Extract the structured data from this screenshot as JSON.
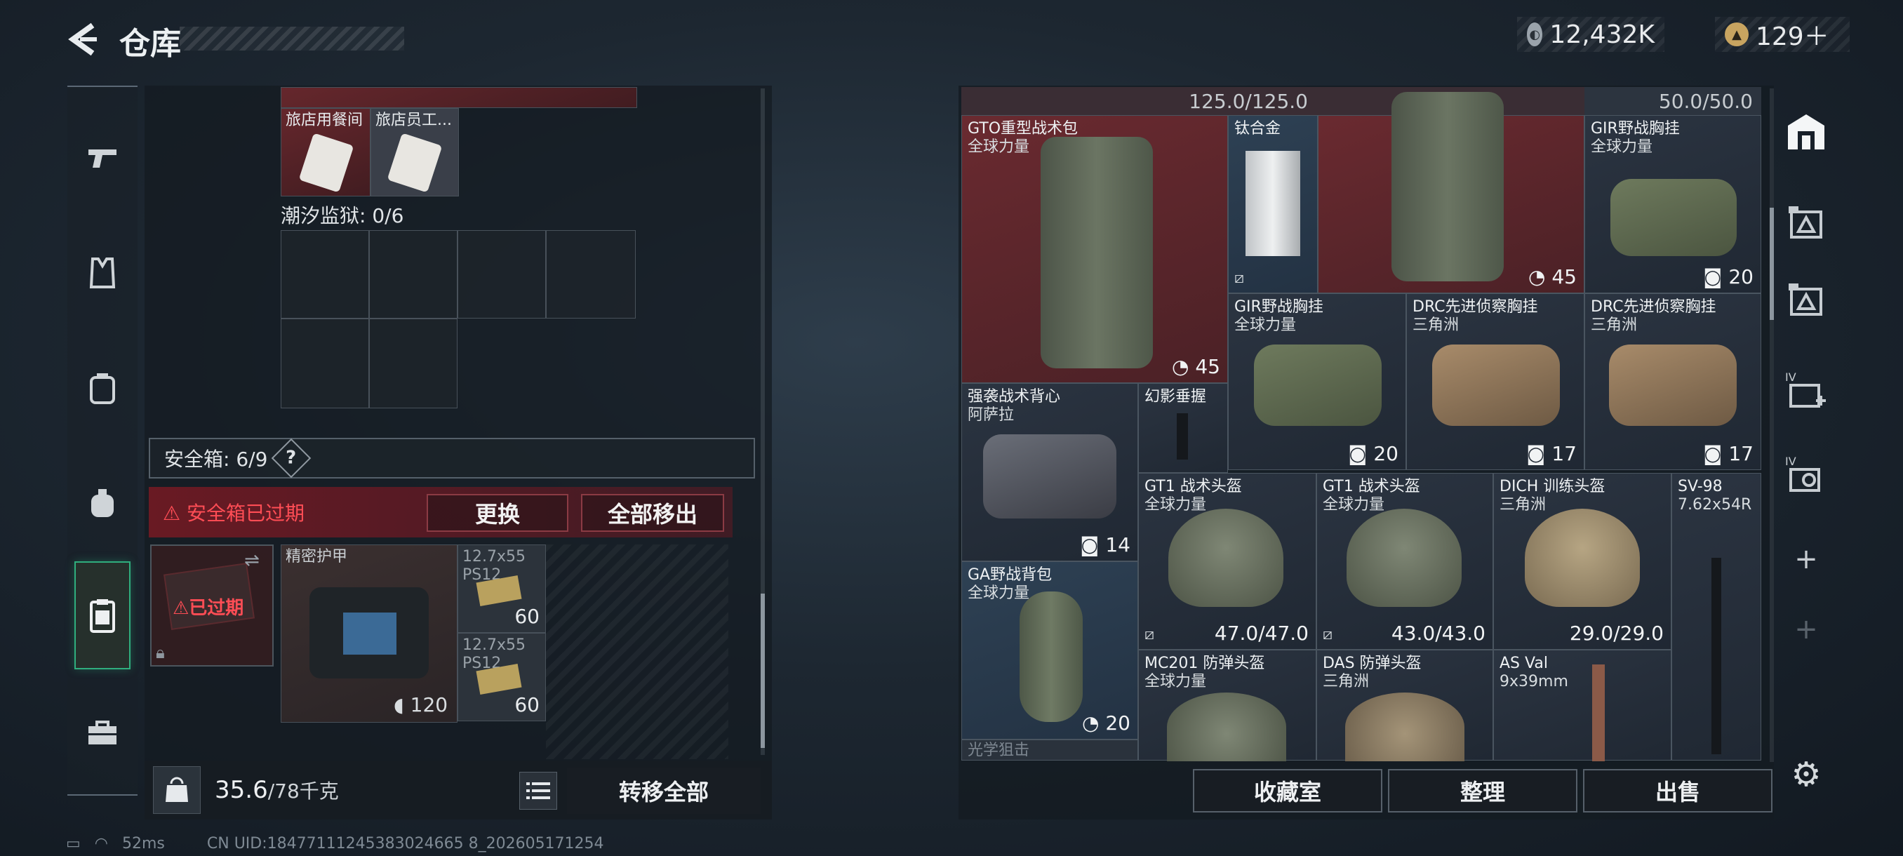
{
  "header": {
    "title": "仓库",
    "currency": [
      {
        "icon": "silver-coin-icon",
        "value": "12,432K"
      },
      {
        "icon": "gold-coin-icon",
        "value": "129＋"
      }
    ]
  },
  "sidebar": {
    "items": [
      {
        "name": "weapon",
        "icon": "pistol-icon"
      },
      {
        "name": "vest",
        "icon": "vest-icon"
      },
      {
        "name": "backpack",
        "icon": "backpack-icon"
      },
      {
        "name": "pouch",
        "icon": "pouch-icon"
      },
      {
        "name": "safebox",
        "icon": "safebox-icon",
        "active": true
      },
      {
        "name": "case",
        "icon": "briefcase-icon"
      }
    ]
  },
  "left": {
    "top_items": [
      {
        "label": "旅店用餐间"
      },
      {
        "label": "旅店员工..."
      }
    ],
    "prison_label": "潮汐监狱: 0/6",
    "safebox_label": "安全箱: 6/9",
    "help": "?",
    "warning": "⚠ 安全箱已过期",
    "replace_btn": "更换",
    "remove_all_btn": "全部移出",
    "expired_badge": "⚠已过期",
    "armor": {
      "label": "精密护甲",
      "count": "120"
    },
    "ammo": [
      {
        "label": "12.7x55\nPS12",
        "count": "60"
      },
      {
        "label": "12.7x55\nPS12",
        "count": "60"
      }
    ],
    "weight": "35.6",
    "weight_max": "/78千克",
    "transfer_all": "转移全部"
  },
  "status": {
    "ping": "52ms",
    "uid": "CN UID:18477111245383024665 8_202605171254"
  },
  "right": {
    "top_counters": [
      "125.0/125.0",
      "50.0/50.0"
    ],
    "items": [
      {
        "id": "gto",
        "name": "GTO重型战术包",
        "sub": "全球力量",
        "count": "45"
      },
      {
        "id": "ti",
        "name": "钛合金",
        "sub": ""
      },
      {
        "id": "bag2",
        "name": "",
        "sub": "",
        "count": "45"
      },
      {
        "id": "gir1",
        "name": "GIR野战胸挂",
        "sub": "全球力量",
        "count": "20"
      },
      {
        "id": "gir2",
        "name": "GIR野战胸挂",
        "sub": "全球力量",
        "count": "20"
      },
      {
        "id": "drc1",
        "name": "DRC先进侦察胸挂",
        "sub": "三角洲",
        "count": "17"
      },
      {
        "id": "drc2",
        "name": "DRC先进侦察胸挂",
        "sub": "三角洲",
        "count": "17"
      },
      {
        "id": "qx",
        "name": "强袭战术背心",
        "sub": "阿萨拉",
        "count": "14"
      },
      {
        "id": "grip",
        "name": "幻影垂握",
        "sub": ""
      },
      {
        "id": "gt1a",
        "name": "GT1 战术头盔",
        "sub": "全球力量",
        "count": "47.0/47.0"
      },
      {
        "id": "gt1b",
        "name": "GT1 战术头盔",
        "sub": "全球力量",
        "count": "43.0/43.0"
      },
      {
        "id": "dich",
        "name": "DICH 训练头盔",
        "sub": "三角洲",
        "count": "29.0/29.0"
      },
      {
        "id": "sv98",
        "name": "SV-98",
        "sub": "7.62x54R"
      },
      {
        "id": "ga",
        "name": "GA野战背包",
        "sub": "全球力量",
        "count": "20"
      },
      {
        "id": "mc201",
        "name": "MC201 防弹头盔",
        "sub": "全球力量"
      },
      {
        "id": "das",
        "name": "DAS 防弹头盔",
        "sub": "三角洲"
      },
      {
        "id": "asval",
        "name": "AS Val",
        "sub": "9x39mm"
      },
      {
        "id": "optic",
        "name": "光学狙击",
        "sub": ""
      }
    ],
    "buttons": {
      "collection": "收藏室",
      "sort": "整理",
      "sell": "出售"
    }
  },
  "right_sidebar": {
    "items": [
      {
        "icon": "warehouse-icon",
        "active": true
      },
      {
        "icon": "tab-icon-1"
      },
      {
        "icon": "tab-icon-2"
      },
      {
        "icon": "tab-icon-4",
        "roman": "IV"
      },
      {
        "icon": "tab-icon-5",
        "roman": "IV"
      },
      {
        "icon": "add-icon",
        "text": "+"
      },
      {
        "icon": "add-icon-dim",
        "text": "+"
      }
    ]
  },
  "colors": {
    "accent_green": "#2fae7e",
    "warn_red": "#ff4d55",
    "item_red": "#6a2a30"
  }
}
